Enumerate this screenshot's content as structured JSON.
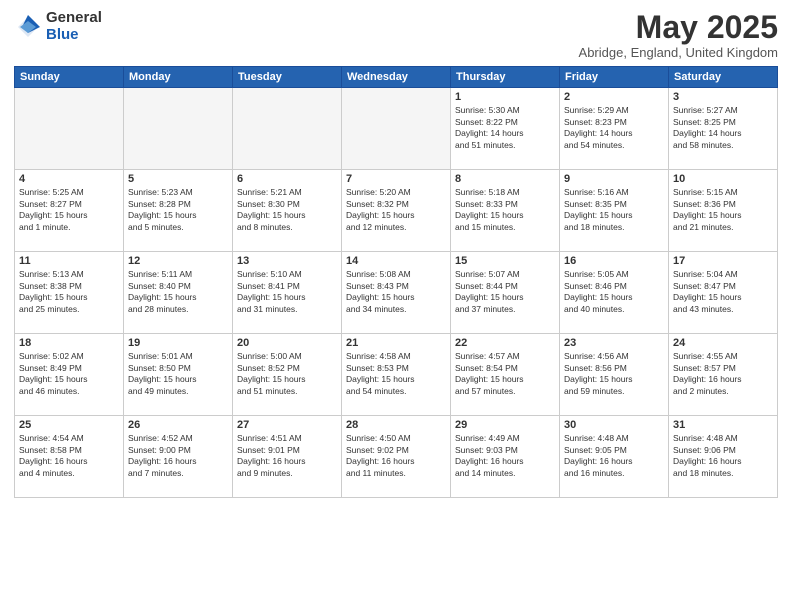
{
  "logo": {
    "general": "General",
    "blue": "Blue"
  },
  "title": "May 2025",
  "location": "Abridge, England, United Kingdom",
  "days_of_week": [
    "Sunday",
    "Monday",
    "Tuesday",
    "Wednesday",
    "Thursday",
    "Friday",
    "Saturday"
  ],
  "weeks": [
    [
      {
        "day": "",
        "info": ""
      },
      {
        "day": "",
        "info": ""
      },
      {
        "day": "",
        "info": ""
      },
      {
        "day": "",
        "info": ""
      },
      {
        "day": "1",
        "info": "Sunrise: 5:30 AM\nSunset: 8:22 PM\nDaylight: 14 hours\nand 51 minutes."
      },
      {
        "day": "2",
        "info": "Sunrise: 5:29 AM\nSunset: 8:23 PM\nDaylight: 14 hours\nand 54 minutes."
      },
      {
        "day": "3",
        "info": "Sunrise: 5:27 AM\nSunset: 8:25 PM\nDaylight: 14 hours\nand 58 minutes."
      }
    ],
    [
      {
        "day": "4",
        "info": "Sunrise: 5:25 AM\nSunset: 8:27 PM\nDaylight: 15 hours\nand 1 minute."
      },
      {
        "day": "5",
        "info": "Sunrise: 5:23 AM\nSunset: 8:28 PM\nDaylight: 15 hours\nand 5 minutes."
      },
      {
        "day": "6",
        "info": "Sunrise: 5:21 AM\nSunset: 8:30 PM\nDaylight: 15 hours\nand 8 minutes."
      },
      {
        "day": "7",
        "info": "Sunrise: 5:20 AM\nSunset: 8:32 PM\nDaylight: 15 hours\nand 12 minutes."
      },
      {
        "day": "8",
        "info": "Sunrise: 5:18 AM\nSunset: 8:33 PM\nDaylight: 15 hours\nand 15 minutes."
      },
      {
        "day": "9",
        "info": "Sunrise: 5:16 AM\nSunset: 8:35 PM\nDaylight: 15 hours\nand 18 minutes."
      },
      {
        "day": "10",
        "info": "Sunrise: 5:15 AM\nSunset: 8:36 PM\nDaylight: 15 hours\nand 21 minutes."
      }
    ],
    [
      {
        "day": "11",
        "info": "Sunrise: 5:13 AM\nSunset: 8:38 PM\nDaylight: 15 hours\nand 25 minutes."
      },
      {
        "day": "12",
        "info": "Sunrise: 5:11 AM\nSunset: 8:40 PM\nDaylight: 15 hours\nand 28 minutes."
      },
      {
        "day": "13",
        "info": "Sunrise: 5:10 AM\nSunset: 8:41 PM\nDaylight: 15 hours\nand 31 minutes."
      },
      {
        "day": "14",
        "info": "Sunrise: 5:08 AM\nSunset: 8:43 PM\nDaylight: 15 hours\nand 34 minutes."
      },
      {
        "day": "15",
        "info": "Sunrise: 5:07 AM\nSunset: 8:44 PM\nDaylight: 15 hours\nand 37 minutes."
      },
      {
        "day": "16",
        "info": "Sunrise: 5:05 AM\nSunset: 8:46 PM\nDaylight: 15 hours\nand 40 minutes."
      },
      {
        "day": "17",
        "info": "Sunrise: 5:04 AM\nSunset: 8:47 PM\nDaylight: 15 hours\nand 43 minutes."
      }
    ],
    [
      {
        "day": "18",
        "info": "Sunrise: 5:02 AM\nSunset: 8:49 PM\nDaylight: 15 hours\nand 46 minutes."
      },
      {
        "day": "19",
        "info": "Sunrise: 5:01 AM\nSunset: 8:50 PM\nDaylight: 15 hours\nand 49 minutes."
      },
      {
        "day": "20",
        "info": "Sunrise: 5:00 AM\nSunset: 8:52 PM\nDaylight: 15 hours\nand 51 minutes."
      },
      {
        "day": "21",
        "info": "Sunrise: 4:58 AM\nSunset: 8:53 PM\nDaylight: 15 hours\nand 54 minutes."
      },
      {
        "day": "22",
        "info": "Sunrise: 4:57 AM\nSunset: 8:54 PM\nDaylight: 15 hours\nand 57 minutes."
      },
      {
        "day": "23",
        "info": "Sunrise: 4:56 AM\nSunset: 8:56 PM\nDaylight: 15 hours\nand 59 minutes."
      },
      {
        "day": "24",
        "info": "Sunrise: 4:55 AM\nSunset: 8:57 PM\nDaylight: 16 hours\nand 2 minutes."
      }
    ],
    [
      {
        "day": "25",
        "info": "Sunrise: 4:54 AM\nSunset: 8:58 PM\nDaylight: 16 hours\nand 4 minutes."
      },
      {
        "day": "26",
        "info": "Sunrise: 4:52 AM\nSunset: 9:00 PM\nDaylight: 16 hours\nand 7 minutes."
      },
      {
        "day": "27",
        "info": "Sunrise: 4:51 AM\nSunset: 9:01 PM\nDaylight: 16 hours\nand 9 minutes."
      },
      {
        "day": "28",
        "info": "Sunrise: 4:50 AM\nSunset: 9:02 PM\nDaylight: 16 hours\nand 11 minutes."
      },
      {
        "day": "29",
        "info": "Sunrise: 4:49 AM\nSunset: 9:03 PM\nDaylight: 16 hours\nand 14 minutes."
      },
      {
        "day": "30",
        "info": "Sunrise: 4:48 AM\nSunset: 9:05 PM\nDaylight: 16 hours\nand 16 minutes."
      },
      {
        "day": "31",
        "info": "Sunrise: 4:48 AM\nSunset: 9:06 PM\nDaylight: 16 hours\nand 18 minutes."
      }
    ]
  ]
}
